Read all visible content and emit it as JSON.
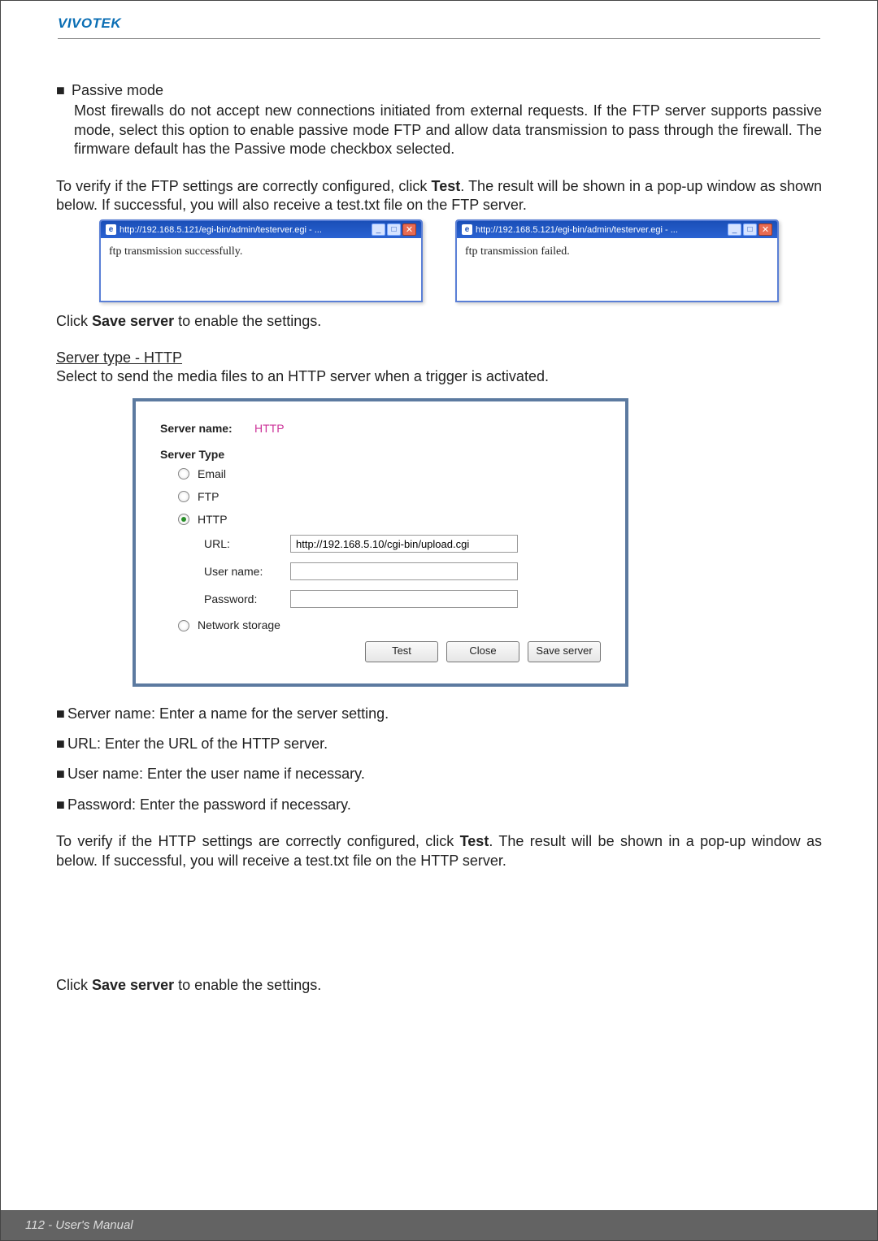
{
  "header": {
    "brand": "VIVOTEK"
  },
  "section1": {
    "bullet_label": "■",
    "passive_title": "Passive mode",
    "passive_desc": "Most firewalls do not accept new connections initiated from external requests. If the FTP server supports passive mode, select this option to enable passive mode FTP and allow data transmission to pass through the firewall. The firmware default has the Passive mode checkbox selected."
  },
  "verify_ftp": {
    "pre": "To verify if the FTP settings are correctly configured, click ",
    "bold": "Test",
    "post": ". The result will be shown in a pop-up window as shown below. If successful, you will also receive a test.txt file on the FTP server."
  },
  "popups": {
    "url": "http://192.168.5.121/egi-bin/admin/testerver.egi - ...",
    "success_msg": "ftp transmission successfully.",
    "fail_msg": "ftp transmission failed."
  },
  "save1": {
    "pre": "Click ",
    "bold": "Save server",
    "post": " to enable the settings."
  },
  "http_heading": {
    "title": "Server type - HTTP",
    "desc": "Select to send the media files to an HTTP server when a trigger is activated."
  },
  "panel": {
    "servername_label": "Server name:",
    "servername_value": "HTTP",
    "servertype_label": "Server Type",
    "opt_email": "Email",
    "opt_ftp": "FTP",
    "opt_http": "HTTP",
    "url_label": "URL:",
    "url_value": "http://192.168.5.10/cgi-bin/upload.cgi",
    "username_label": "User name:",
    "password_label": "Password:",
    "opt_network": "Network storage",
    "btn_test": "Test",
    "btn_close": "Close",
    "btn_save": "Save server"
  },
  "list": {
    "i1": "Server name: Enter a name for the server setting.",
    "i2": "URL: Enter the URL of the HTTP server.",
    "i3": "User name: Enter the user name if necessary.",
    "i4": "Password: Enter the password if necessary."
  },
  "verify_http": {
    "pre": "To verify if the HTTP settings are correctly configured, click ",
    "bold": "Test",
    "post": ". The result will be shown in a pop-up window as below. If successful, you will receive a test.txt file on the HTTP server."
  },
  "save2": {
    "pre": "Click ",
    "bold": "Save server",
    "post": " to enable the settings."
  },
  "footer": {
    "text": "112 - User's Manual"
  }
}
